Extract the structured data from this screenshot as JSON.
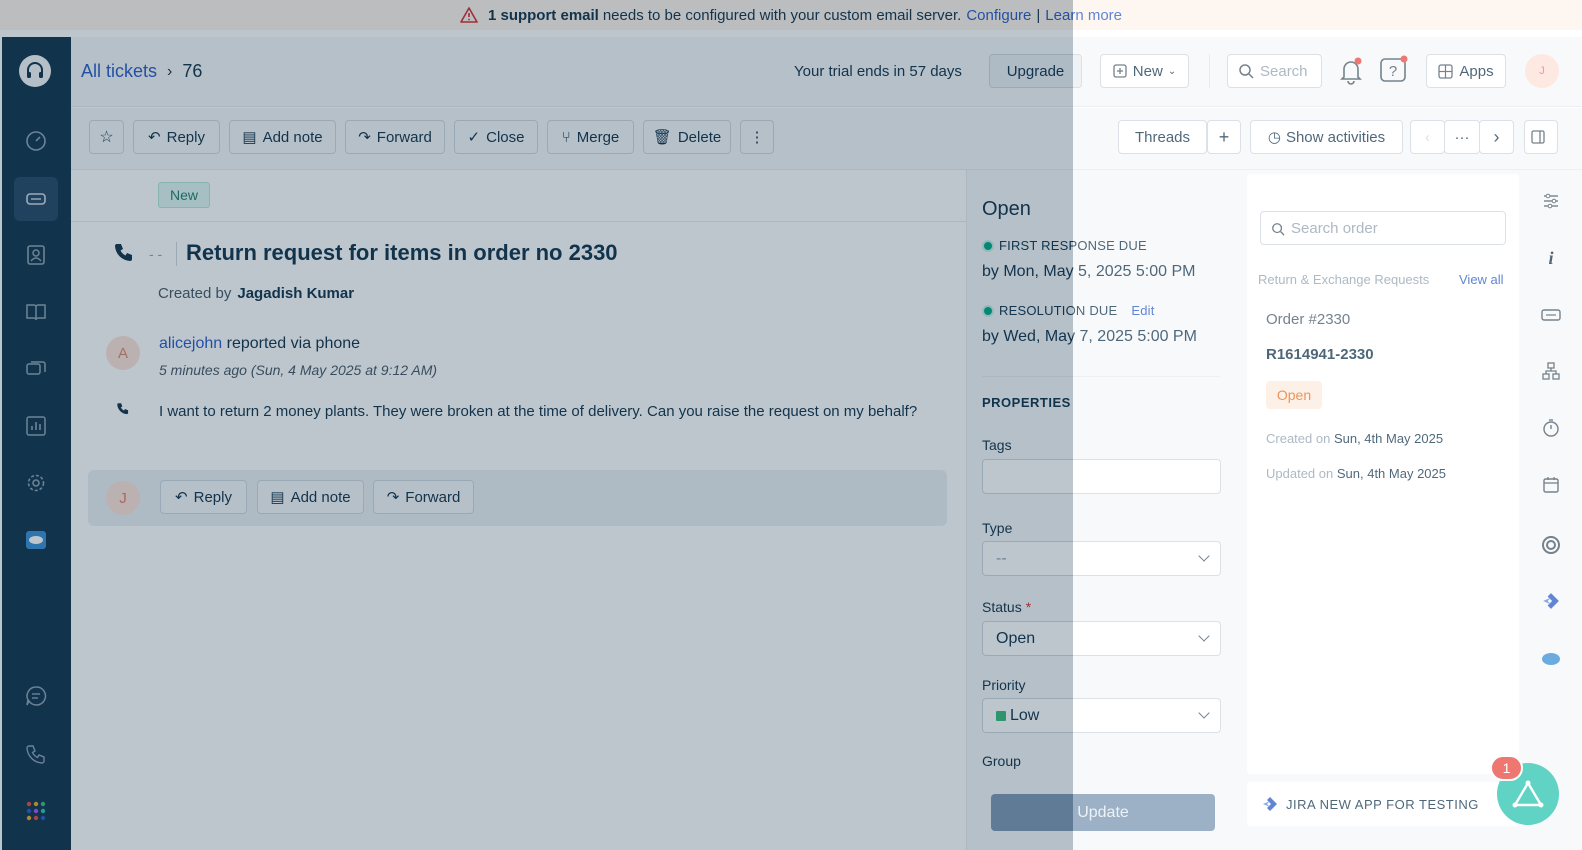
{
  "banner": {
    "bold": "1 support email",
    "text": "needs to be configured with your custom email server.",
    "configure": "Configure",
    "separator": "|",
    "learn_more": "Learn more"
  },
  "header": {
    "breadcrumb_root": "All tickets",
    "breadcrumb_current": "76",
    "trial_text": "Your trial ends in 57 days",
    "upgrade": "Upgrade",
    "new": "New",
    "search": "Search",
    "apps": "Apps",
    "avatar": "J"
  },
  "toolbar": {
    "reply": "Reply",
    "add_note": "Add note",
    "forward": "Forward",
    "close": "Close",
    "merge": "Merge",
    "delete": "Delete",
    "more": "⋮",
    "threads": "Threads",
    "plus": "+",
    "show_activities": "Show activities",
    "nav_more": "···"
  },
  "ticket": {
    "badge": "New",
    "placeholder_dashes": "- -",
    "subject": "Return request for items in order no 2330",
    "created_label": "Created by",
    "created_by": "Jagadish Kumar",
    "author_avatar": "A",
    "author": "alicejohn",
    "reported": "reported via phone",
    "time": "5 minutes ago (Sun, 4 May 2025 at 9:12 AM)",
    "message": "I want to return 2 money plants. They were broken at the time of delivery. Can you raise the request on my behalf?",
    "reply_avatar": "J",
    "reply": "Reply",
    "add_note": "Add note",
    "forward": "Forward"
  },
  "properties": {
    "status_title": "Open",
    "first_response_label": "FIRST RESPONSE DUE",
    "first_response_value": "by Mon, May 5, 2025 5:00 PM",
    "resolution_label": "RESOLUTION DUE",
    "edit": "Edit",
    "resolution_value": "by Wed, May 7, 2025 5:00 PM",
    "section": "PROPERTIES",
    "tags_label": "Tags",
    "type_label": "Type",
    "type_value": "--",
    "status_label": "Status",
    "required_mark": "*",
    "status_value": "Open",
    "priority_label": "Priority",
    "priority_value": "Low",
    "group_label": "Group",
    "update": "Update"
  },
  "app_panel": {
    "search_placeholder": "Search order",
    "section": "Return & Exchange Requests",
    "view_all": "View all",
    "order": "Order #2330",
    "order_id": "R1614941-2330",
    "status": "Open",
    "created_label": "Created on",
    "created_value": "Sun, 4th May 2025",
    "updated_label": "Updated on",
    "updated_value": "Sun, 4th May 2025",
    "jira": "JIRA NEW APP FOR TESTING"
  },
  "fab_badge": "1",
  "colors": {
    "sidebar": "#12344d",
    "link": "#2c5cc5",
    "success": "#00a886",
    "fab": "#2bc4b0",
    "badge_red": "#e94a43"
  }
}
